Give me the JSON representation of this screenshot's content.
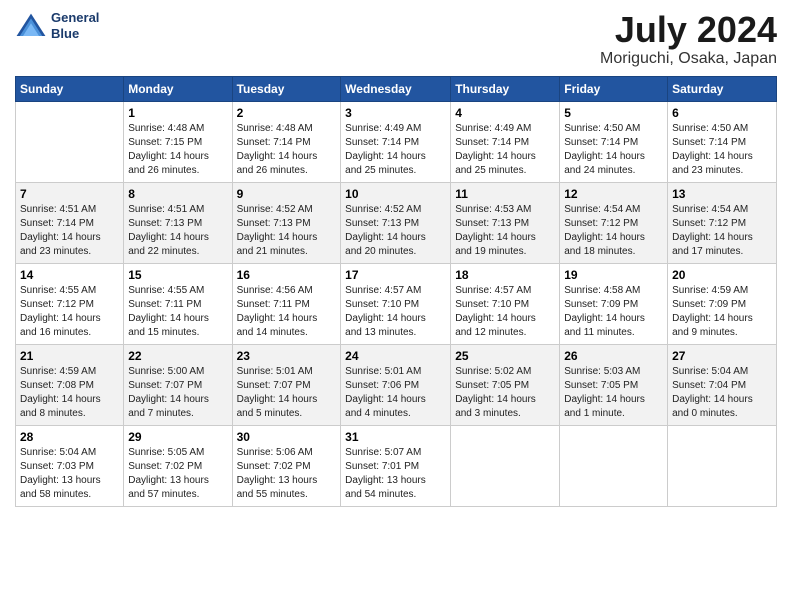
{
  "header": {
    "logo_line1": "General",
    "logo_line2": "Blue",
    "title": "July 2024",
    "subtitle": "Moriguchi, Osaka, Japan"
  },
  "columns": [
    "Sunday",
    "Monday",
    "Tuesday",
    "Wednesday",
    "Thursday",
    "Friday",
    "Saturday"
  ],
  "weeks": [
    [
      {
        "day": "",
        "info": ""
      },
      {
        "day": "1",
        "info": "Sunrise: 4:48 AM\nSunset: 7:15 PM\nDaylight: 14 hours\nand 26 minutes."
      },
      {
        "day": "2",
        "info": "Sunrise: 4:48 AM\nSunset: 7:14 PM\nDaylight: 14 hours\nand 26 minutes."
      },
      {
        "day": "3",
        "info": "Sunrise: 4:49 AM\nSunset: 7:14 PM\nDaylight: 14 hours\nand 25 minutes."
      },
      {
        "day": "4",
        "info": "Sunrise: 4:49 AM\nSunset: 7:14 PM\nDaylight: 14 hours\nand 25 minutes."
      },
      {
        "day": "5",
        "info": "Sunrise: 4:50 AM\nSunset: 7:14 PM\nDaylight: 14 hours\nand 24 minutes."
      },
      {
        "day": "6",
        "info": "Sunrise: 4:50 AM\nSunset: 7:14 PM\nDaylight: 14 hours\nand 23 minutes."
      }
    ],
    [
      {
        "day": "7",
        "info": "Sunrise: 4:51 AM\nSunset: 7:14 PM\nDaylight: 14 hours\nand 23 minutes."
      },
      {
        "day": "8",
        "info": "Sunrise: 4:51 AM\nSunset: 7:13 PM\nDaylight: 14 hours\nand 22 minutes."
      },
      {
        "day": "9",
        "info": "Sunrise: 4:52 AM\nSunset: 7:13 PM\nDaylight: 14 hours\nand 21 minutes."
      },
      {
        "day": "10",
        "info": "Sunrise: 4:52 AM\nSunset: 7:13 PM\nDaylight: 14 hours\nand 20 minutes."
      },
      {
        "day": "11",
        "info": "Sunrise: 4:53 AM\nSunset: 7:13 PM\nDaylight: 14 hours\nand 19 minutes."
      },
      {
        "day": "12",
        "info": "Sunrise: 4:54 AM\nSunset: 7:12 PM\nDaylight: 14 hours\nand 18 minutes."
      },
      {
        "day": "13",
        "info": "Sunrise: 4:54 AM\nSunset: 7:12 PM\nDaylight: 14 hours\nand 17 minutes."
      }
    ],
    [
      {
        "day": "14",
        "info": "Sunrise: 4:55 AM\nSunset: 7:12 PM\nDaylight: 14 hours\nand 16 minutes."
      },
      {
        "day": "15",
        "info": "Sunrise: 4:55 AM\nSunset: 7:11 PM\nDaylight: 14 hours\nand 15 minutes."
      },
      {
        "day": "16",
        "info": "Sunrise: 4:56 AM\nSunset: 7:11 PM\nDaylight: 14 hours\nand 14 minutes."
      },
      {
        "day": "17",
        "info": "Sunrise: 4:57 AM\nSunset: 7:10 PM\nDaylight: 14 hours\nand 13 minutes."
      },
      {
        "day": "18",
        "info": "Sunrise: 4:57 AM\nSunset: 7:10 PM\nDaylight: 14 hours\nand 12 minutes."
      },
      {
        "day": "19",
        "info": "Sunrise: 4:58 AM\nSunset: 7:09 PM\nDaylight: 14 hours\nand 11 minutes."
      },
      {
        "day": "20",
        "info": "Sunrise: 4:59 AM\nSunset: 7:09 PM\nDaylight: 14 hours\nand 9 minutes."
      }
    ],
    [
      {
        "day": "21",
        "info": "Sunrise: 4:59 AM\nSunset: 7:08 PM\nDaylight: 14 hours\nand 8 minutes."
      },
      {
        "day": "22",
        "info": "Sunrise: 5:00 AM\nSunset: 7:07 PM\nDaylight: 14 hours\nand 7 minutes."
      },
      {
        "day": "23",
        "info": "Sunrise: 5:01 AM\nSunset: 7:07 PM\nDaylight: 14 hours\nand 5 minutes."
      },
      {
        "day": "24",
        "info": "Sunrise: 5:01 AM\nSunset: 7:06 PM\nDaylight: 14 hours\nand 4 minutes."
      },
      {
        "day": "25",
        "info": "Sunrise: 5:02 AM\nSunset: 7:05 PM\nDaylight: 14 hours\nand 3 minutes."
      },
      {
        "day": "26",
        "info": "Sunrise: 5:03 AM\nSunset: 7:05 PM\nDaylight: 14 hours\nand 1 minute."
      },
      {
        "day": "27",
        "info": "Sunrise: 5:04 AM\nSunset: 7:04 PM\nDaylight: 14 hours\nand 0 minutes."
      }
    ],
    [
      {
        "day": "28",
        "info": "Sunrise: 5:04 AM\nSunset: 7:03 PM\nDaylight: 13 hours\nand 58 minutes."
      },
      {
        "day": "29",
        "info": "Sunrise: 5:05 AM\nSunset: 7:02 PM\nDaylight: 13 hours\nand 57 minutes."
      },
      {
        "day": "30",
        "info": "Sunrise: 5:06 AM\nSunset: 7:02 PM\nDaylight: 13 hours\nand 55 minutes."
      },
      {
        "day": "31",
        "info": "Sunrise: 5:07 AM\nSunset: 7:01 PM\nDaylight: 13 hours\nand 54 minutes."
      },
      {
        "day": "",
        "info": ""
      },
      {
        "day": "",
        "info": ""
      },
      {
        "day": "",
        "info": ""
      }
    ]
  ]
}
